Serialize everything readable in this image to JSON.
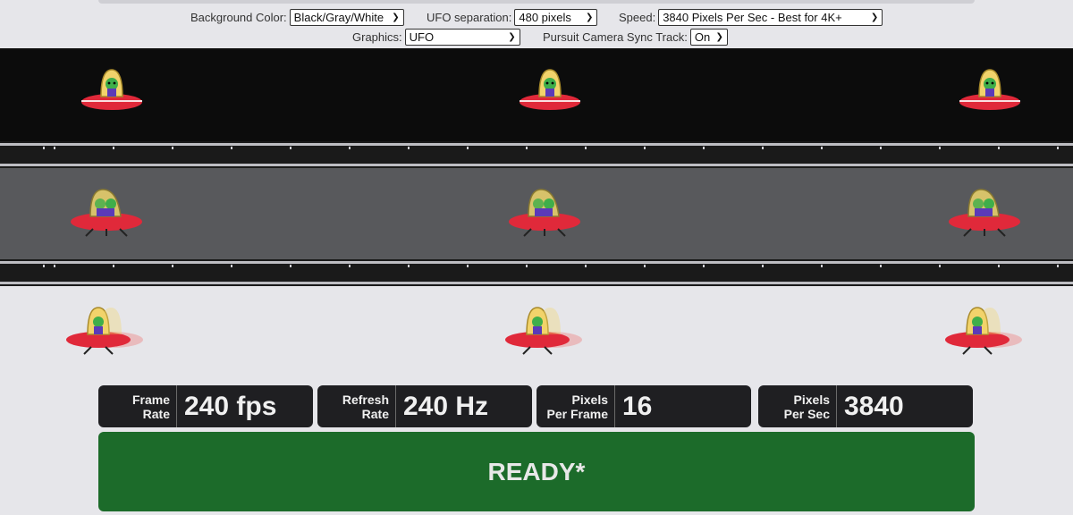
{
  "controls": {
    "background_color": {
      "label": "Background Color:",
      "value": "Black/Gray/White"
    },
    "ufo_separation": {
      "label": "UFO separation:",
      "value": "480 pixels"
    },
    "speed": {
      "label": "Speed:",
      "value": "3840 Pixels Per Sec - Best for 4K+"
    },
    "graphics": {
      "label": "Graphics:",
      "value": "UFO"
    },
    "pursuit_camera": {
      "label": "Pursuit Camera Sync Track:",
      "value": "On"
    }
  },
  "icons": {
    "select_chevron": "chevron-down-icon",
    "ufo": "ufo-alien-icon"
  },
  "colors": {
    "black_band": "#0c0c0c",
    "gray_band": "#58595c",
    "white_band": "#e6e6ea",
    "ready_green": "#1c6b2a",
    "ufo_red": "#e0293a"
  },
  "stats": [
    {
      "label_line1": "Frame",
      "label_line2": "Rate",
      "value": "240 fps"
    },
    {
      "label_line1": "Refresh",
      "label_line2": "Rate",
      "value": "240 Hz"
    },
    {
      "label_line1": "Pixels",
      "label_line2": "Per Frame",
      "value": "16"
    },
    {
      "label_line1": "Pixels",
      "label_line2": "Per Sec",
      "value": "3840"
    }
  ],
  "status": {
    "text": "READY*"
  }
}
